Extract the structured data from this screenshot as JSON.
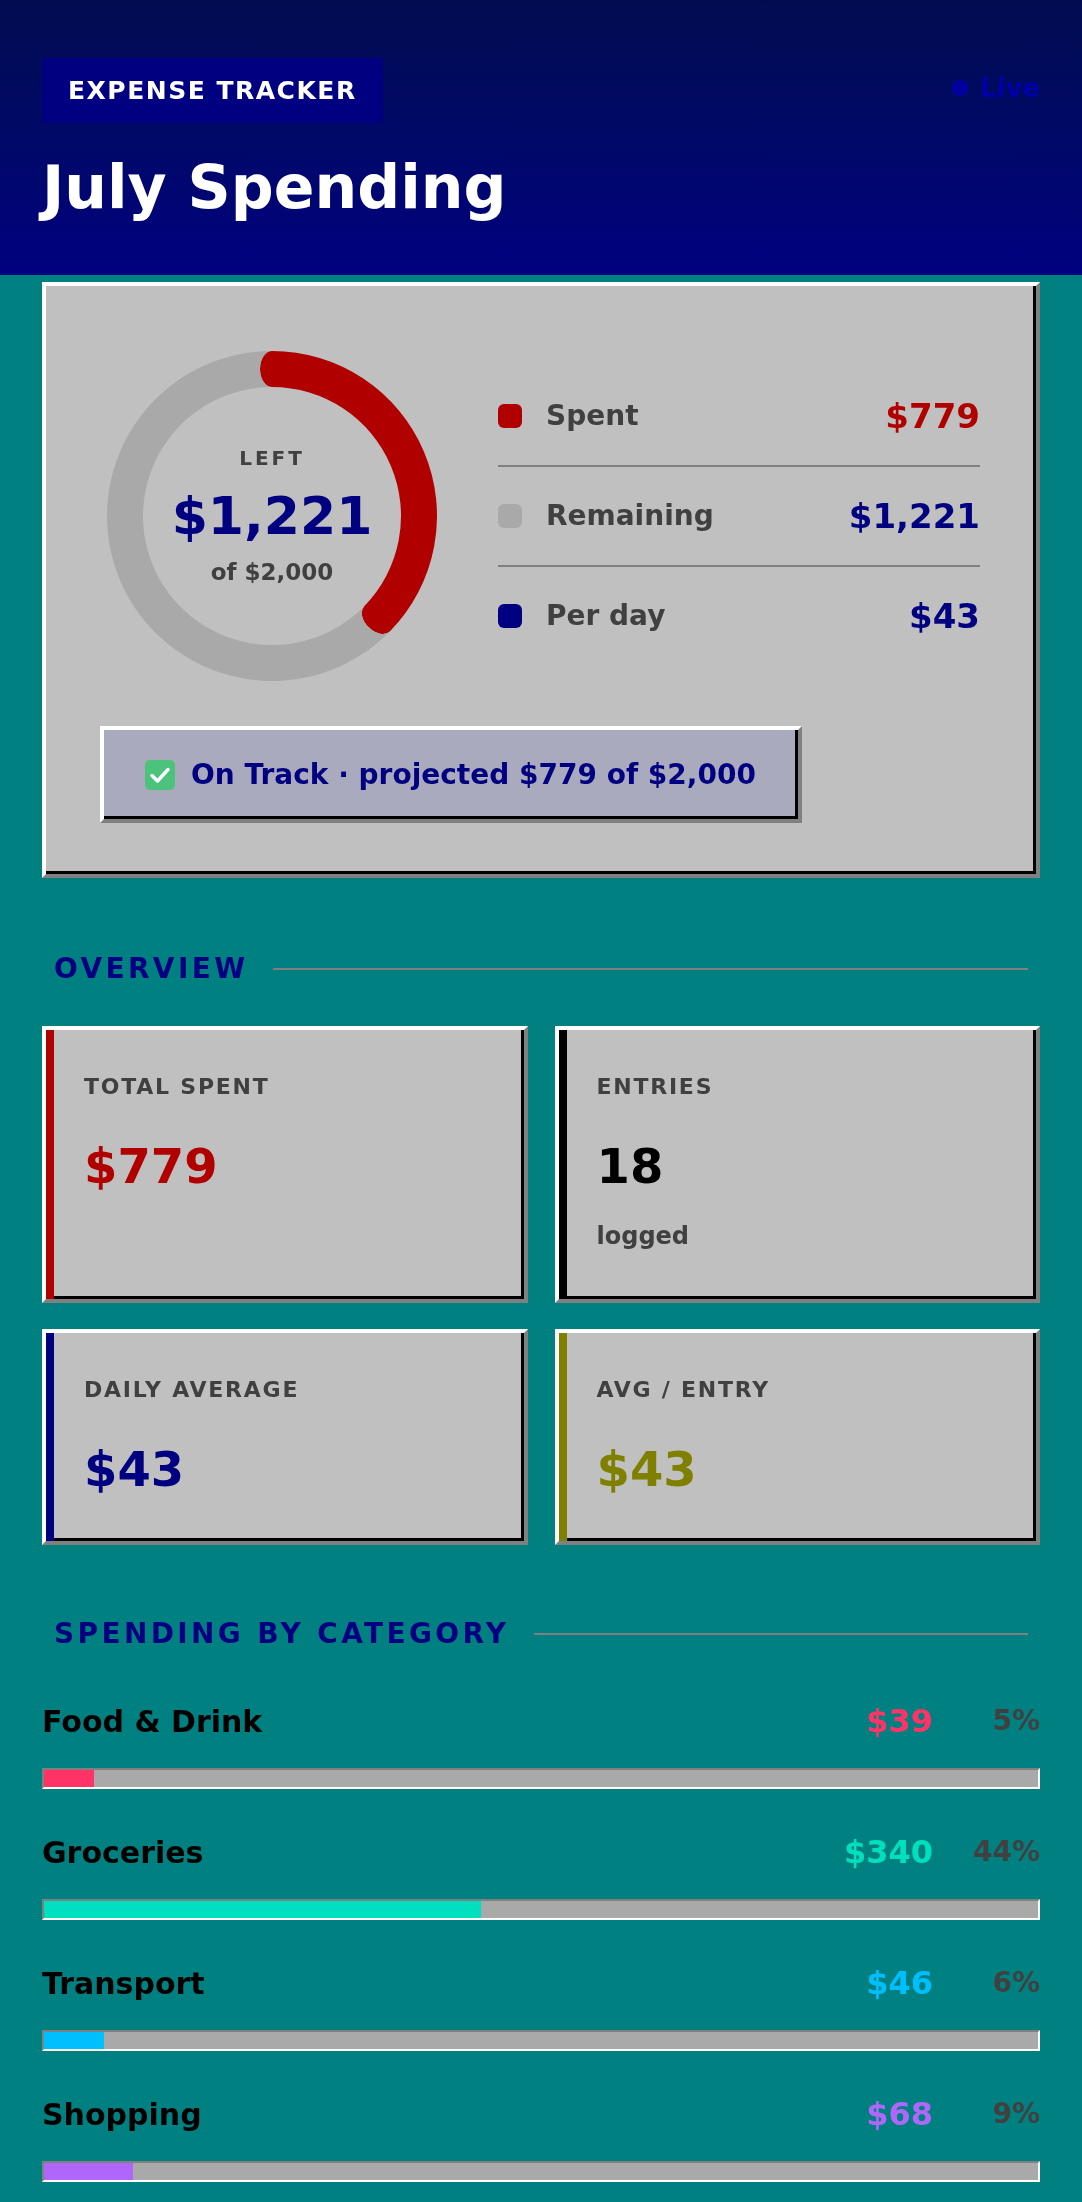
{
  "header": {
    "badge": "EXPENSE TRACKER",
    "live": "Live",
    "title": "July Spending"
  },
  "summary": {
    "chart_data": {
      "type": "donut",
      "values": [
        38.95,
        61.05
      ]
    },
    "ring": {
      "label": "LEFT",
      "amount": "$1,221",
      "caption": "of $2,000"
    },
    "legend": [
      {
        "kind": "spent",
        "label": "Spent",
        "value": "$779",
        "color": "#b00000"
      },
      {
        "kind": "remaining",
        "label": "Remaining",
        "value": "$1,221",
        "color": "#a9a9a9"
      },
      {
        "kind": "rate",
        "label": "Per day",
        "value": "$43",
        "color": "#000080"
      }
    ],
    "status": {
      "on_track": true,
      "text": "On Track · projected $779 of $2,000"
    }
  },
  "overview": {
    "title": "OVERVIEW",
    "stats": [
      {
        "label": "TOTAL SPENT",
        "value": "$779",
        "color": "#b00000"
      },
      {
        "label": "ENTRIES",
        "value": "18",
        "note": "logged",
        "color": "#000000"
      },
      {
        "label": "DAILY AVERAGE",
        "value": "$43",
        "color": "#000080"
      },
      {
        "label": "AVG / ENTRY",
        "value": "$43",
        "color": "#808000"
      }
    ]
  },
  "categories": {
    "title": "SPENDING BY CATEGORY",
    "items": [
      {
        "name": "Food & Drink",
        "amount": "$39",
        "percent": "5%",
        "level": 0.05,
        "color": "#ff3366"
      },
      {
        "name": "Groceries",
        "amount": "$340",
        "percent": "44%",
        "level": 0.44,
        "color": "#00e0c0"
      },
      {
        "name": "Transport",
        "amount": "$46",
        "percent": "6%",
        "level": 0.06,
        "color": "#00bfff"
      },
      {
        "name": "Shopping",
        "amount": "$68",
        "percent": "9%",
        "level": 0.09,
        "color": "#b066fa"
      }
    ]
  }
}
